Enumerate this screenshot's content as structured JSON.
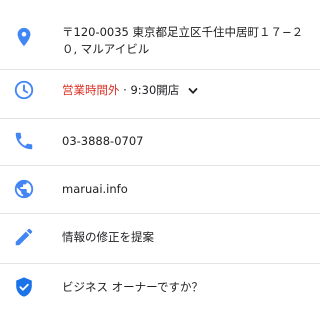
{
  "colors": {
    "icon_blue": "#4285f4",
    "icon_blue_dark": "#1a73e8",
    "closed_red": "#d93025",
    "text": "#202124",
    "divider": "#e3e3e3"
  },
  "rows": [
    {
      "icon": "location-pin-icon",
      "line1": "〒120-0035 東京都足立区千住中居町１７−２",
      "line2": "０, マルアイビル"
    },
    {
      "icon": "clock-icon",
      "status": "営業時間外",
      "separator": " · ",
      "hours": "9:30開店"
    },
    {
      "icon": "phone-icon",
      "text": "03-3888-0707"
    },
    {
      "icon": "globe-icon",
      "text": "maruai.info"
    },
    {
      "icon": "pencil-icon",
      "text": "情報の修正を提案"
    },
    {
      "icon": "shield-check-icon",
      "text": "ビジネス オーナーですか？"
    }
  ]
}
